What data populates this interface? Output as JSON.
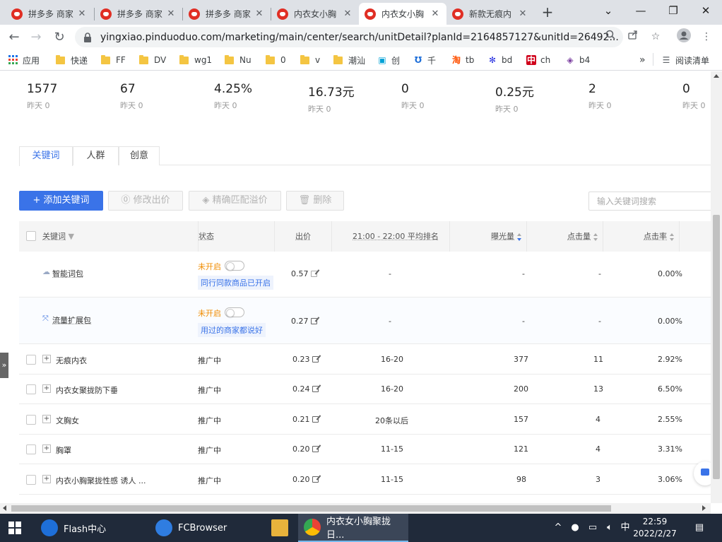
{
  "browser": {
    "tabs": [
      {
        "title": "拼多多 商家",
        "active": false
      },
      {
        "title": "拼多多 商家",
        "active": false
      },
      {
        "title": "拼多多 商家",
        "active": false
      },
      {
        "title": "内衣女小胸",
        "active": false
      },
      {
        "title": "内衣女小胸",
        "active": true
      },
      {
        "title": "新款无痕内",
        "active": false
      }
    ],
    "url": "yingxiao.pinduoduo.com/marketing/main/center/search/unitDetail?planId=2164857127&unitId=26492...",
    "bookmarks": [
      {
        "label": "应用",
        "type": "apps"
      },
      {
        "label": "快递",
        "type": "folder"
      },
      {
        "label": "FF",
        "type": "folder"
      },
      {
        "label": "DV",
        "type": "folder"
      },
      {
        "label": "wg1",
        "type": "folder"
      },
      {
        "label": "Nu",
        "type": "folder"
      },
      {
        "label": "0",
        "type": "folder"
      },
      {
        "label": "v",
        "type": "folder"
      },
      {
        "label": "潮汕",
        "type": "folder"
      },
      {
        "label": "创",
        "type": "bilibili"
      },
      {
        "label": "千",
        "type": "qianniu"
      },
      {
        "label": "tb",
        "type": "taobao"
      },
      {
        "label": "bd",
        "type": "baidu"
      },
      {
        "label": "ch",
        "type": "ch"
      },
      {
        "label": "b4",
        "type": "b4"
      }
    ],
    "more_bookmarks": "»",
    "reading_list": "阅读清单"
  },
  "stats": [
    {
      "value": "1577",
      "sub": "昨天 0"
    },
    {
      "value": "67",
      "sub": "昨天 0"
    },
    {
      "value": "4.25%",
      "sub": "昨天 0"
    },
    {
      "value": "16.73元",
      "sub": "昨天 0"
    },
    {
      "value": "0",
      "sub": "昨天 0"
    },
    {
      "value": "0.25元",
      "sub": "昨天 0"
    },
    {
      "value": "2",
      "sub": "昨天 0"
    },
    {
      "value": "0",
      "sub": "昨天 0"
    }
  ],
  "content_tabs": [
    {
      "label": "关键词",
      "active": true
    },
    {
      "label": "人群",
      "active": false
    },
    {
      "label": "创意",
      "active": false
    }
  ],
  "actions": {
    "add_keyword": "+ 添加关键词",
    "modify_bid": "修改出价",
    "exact_match": "精确匹配溢价",
    "delete": "删除",
    "search_placeholder": "输入关键词搜索"
  },
  "table": {
    "columns": {
      "keyword": "关键词",
      "status": "状态",
      "bid": "出价",
      "rank": "21:00 - 22:00 平均排名",
      "impressions": "曝光量",
      "clicks": "点击量",
      "ctr": "点击率"
    },
    "packages": [
      {
        "name": "智能词包",
        "status": "未开启",
        "tag": "同行同款商品已开启",
        "bid": "0.57",
        "rank": "-",
        "impressions": "-",
        "clicks": "-",
        "ctr": "0.00%"
      },
      {
        "name": "流量扩展包",
        "status": "未开启",
        "tag": "用过的商家都说好",
        "bid": "0.27",
        "rank": "-",
        "impressions": "-",
        "clicks": "-",
        "ctr": "0.00%"
      }
    ],
    "rows": [
      {
        "keyword": "无痕内衣",
        "status": "推广中",
        "bid": "0.23",
        "rank": "16-20",
        "impressions": "377",
        "clicks": "11",
        "ctr": "2.92%"
      },
      {
        "keyword": "内衣女聚拢防下垂",
        "status": "推广中",
        "bid": "0.24",
        "rank": "16-20",
        "impressions": "200",
        "clicks": "13",
        "ctr": "6.50%"
      },
      {
        "keyword": "文胸女",
        "status": "推广中",
        "bid": "0.21",
        "rank": "20条以后",
        "impressions": "157",
        "clicks": "4",
        "ctr": "2.55%"
      },
      {
        "keyword": "胸罩",
        "status": "推广中",
        "bid": "0.20",
        "rank": "11-15",
        "impressions": "121",
        "clicks": "4",
        "ctr": "3.31%"
      },
      {
        "keyword": "内衣小胸聚拢性感 诱人 ...",
        "status": "推广中",
        "bid": "0.20",
        "rank": "11-15",
        "impressions": "98",
        "clicks": "3",
        "ctr": "3.06%"
      }
    ]
  },
  "taskbar": {
    "items": [
      {
        "label": "Flash中心",
        "color": "#1e6fd9"
      },
      {
        "label": "FCBrowser",
        "color": "#2f7de1"
      },
      {
        "label": "",
        "color": "#e8b33c"
      },
      {
        "label": "内衣女小胸聚拢日...",
        "color": "#ea4335"
      }
    ],
    "ime": "中",
    "time": "22:59",
    "date": "2022/2/27"
  },
  "colors": {
    "accent": "#3a73e8",
    "warning": "#f08c00",
    "brand": "#e02e24"
  }
}
